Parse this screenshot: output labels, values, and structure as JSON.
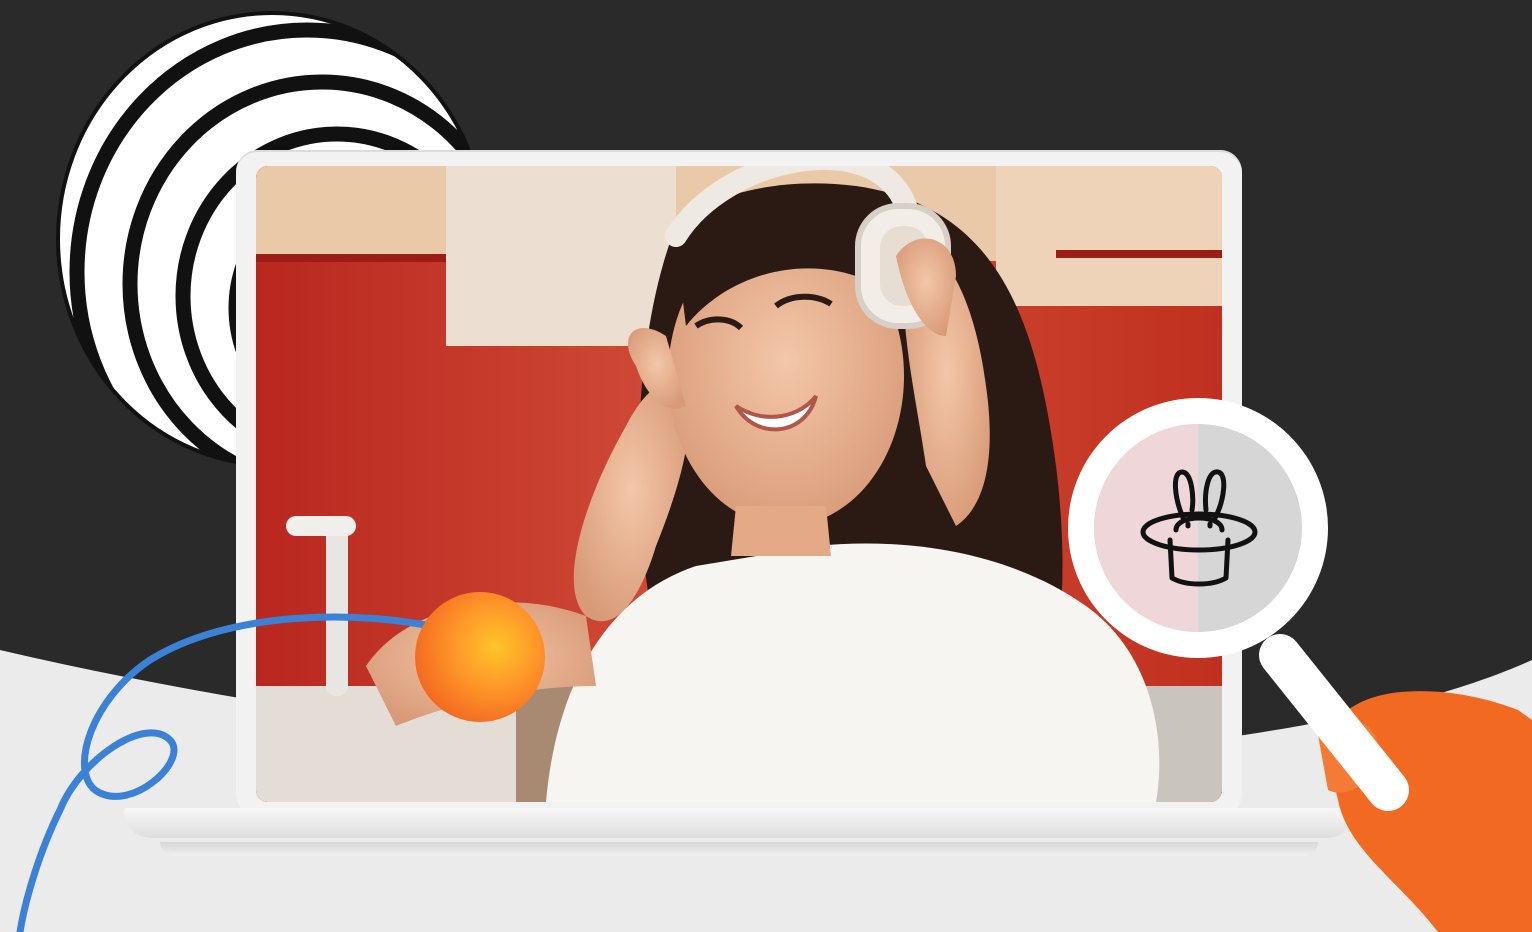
{
  "scene": {
    "background_color": "#2a2a2a",
    "lower_color": "#ebebeb",
    "accent_orange": "#f26a21",
    "accent_blue": "#3b82d6",
    "photo_subject": "woman-with-headphones"
  },
  "icons": {
    "magnifier": "magnifier-icon",
    "hat_rabbit": "magic-hat-rabbit-icon"
  }
}
